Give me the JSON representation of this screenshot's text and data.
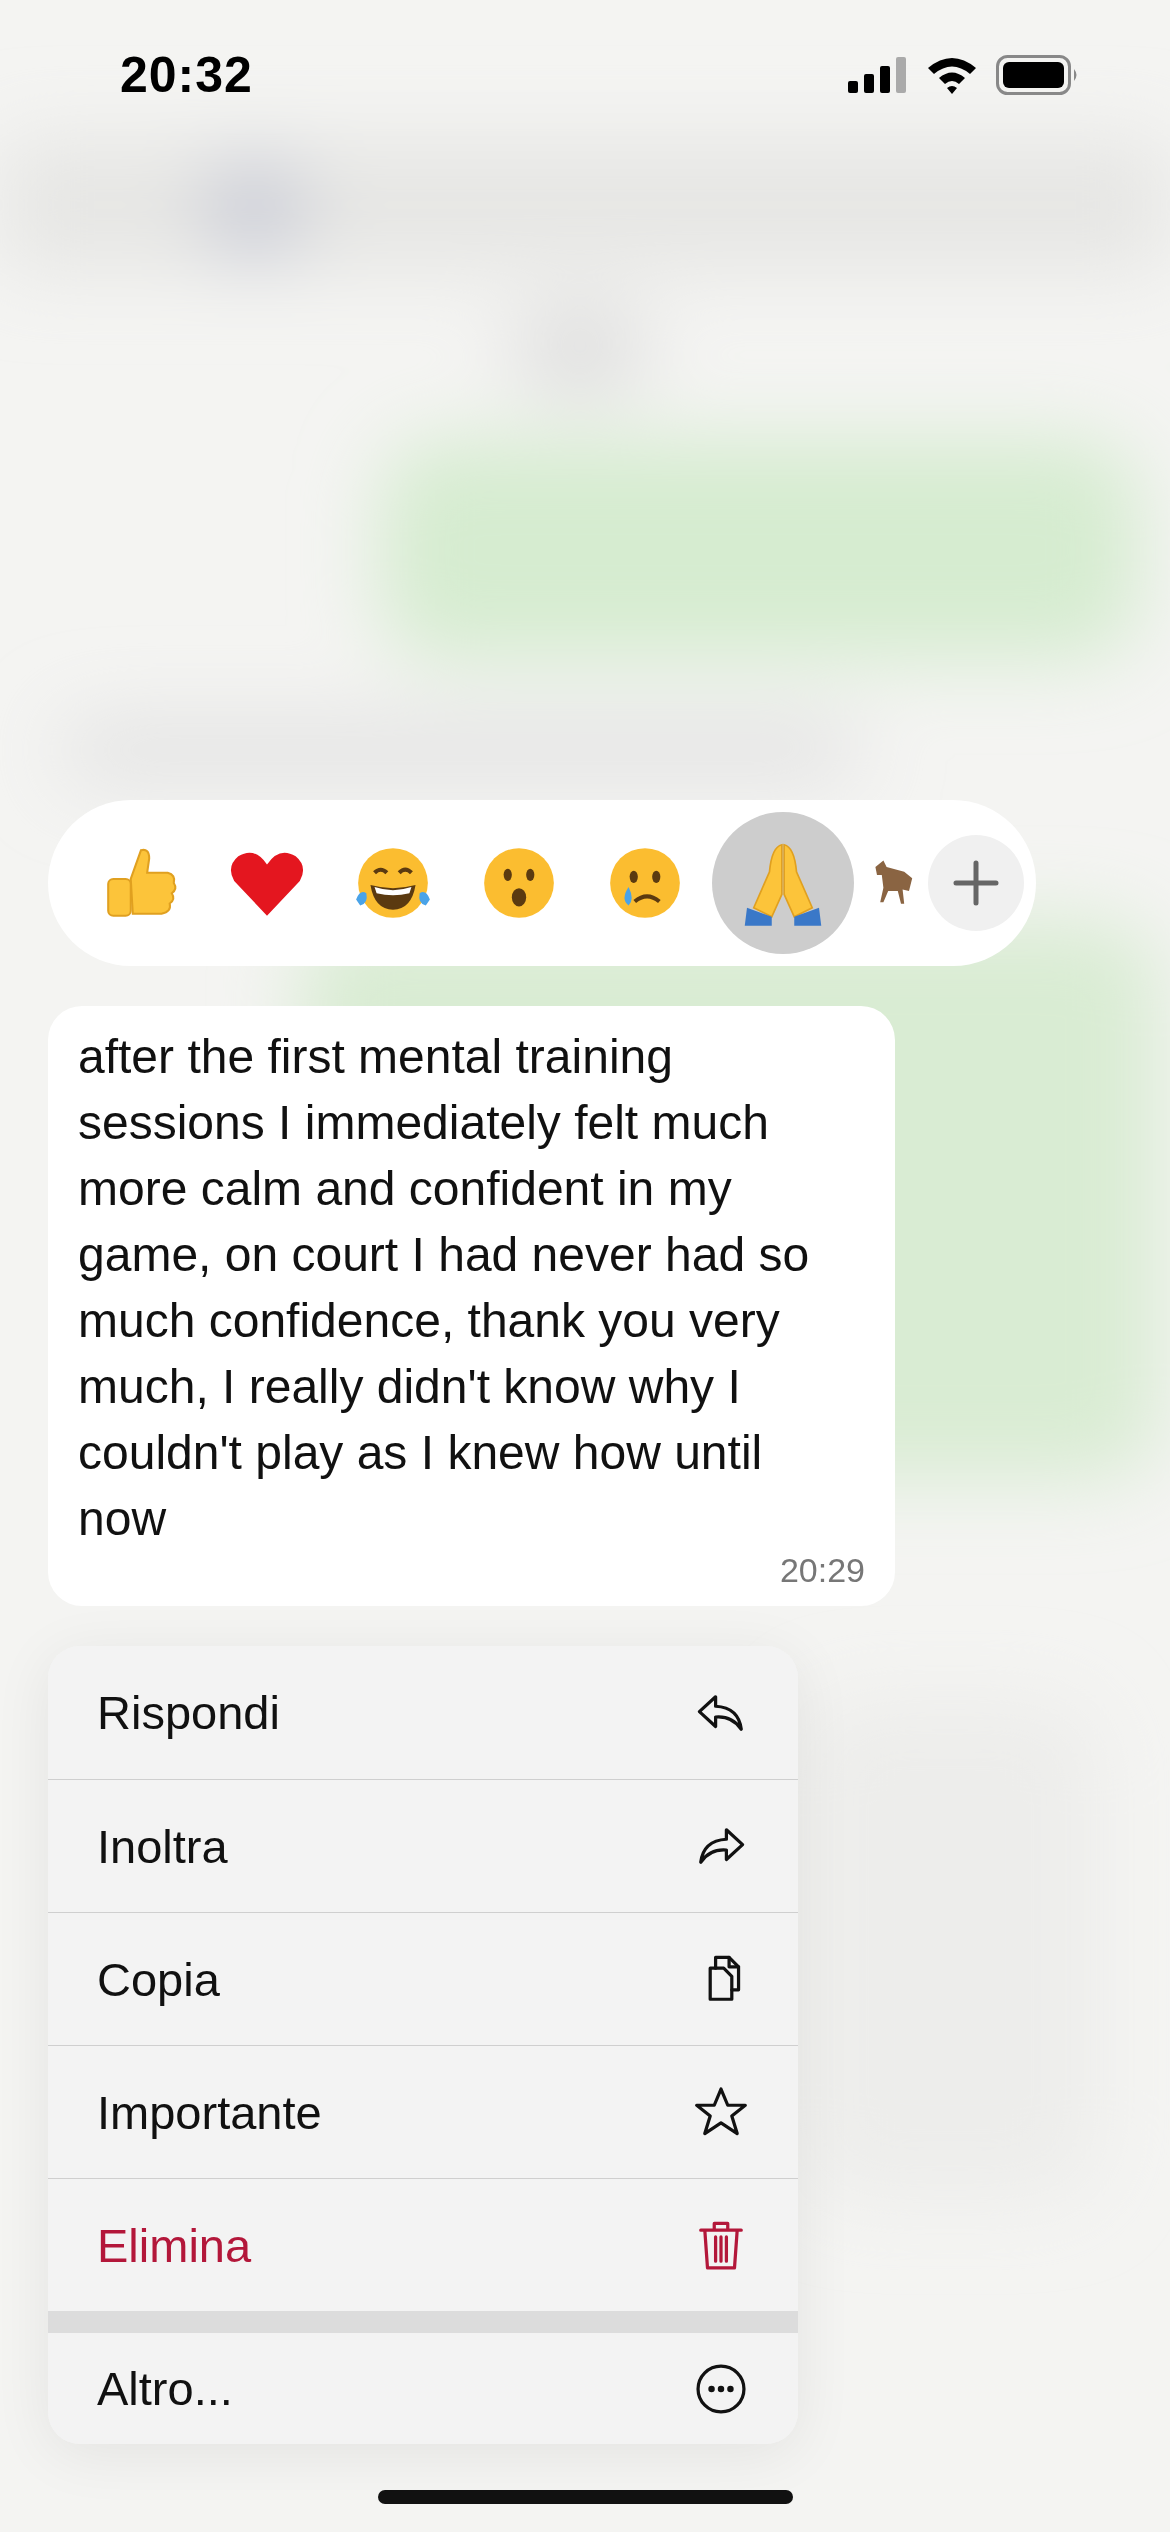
{
  "status_bar": {
    "time": "20:32"
  },
  "reactions": [
    {
      "kind": "thumbs_up",
      "selected": false
    },
    {
      "kind": "heart",
      "selected": false
    },
    {
      "kind": "laugh",
      "selected": false
    },
    {
      "kind": "surprised",
      "selected": false
    },
    {
      "kind": "sad",
      "selected": false
    },
    {
      "kind": "pray",
      "selected": true
    },
    {
      "kind": "horse",
      "selected": false
    }
  ],
  "message": {
    "text": "after the first mental training sessions I immediately felt much more calm and confident in my game, on court I had never had so much confidence, thank you very much, I really didn't know why I couldn't play as I knew how until now",
    "time": "20:29"
  },
  "menu": [
    {
      "label": "Rispondi",
      "kind": "reply",
      "destructive": false
    },
    {
      "label": "Inoltra",
      "kind": "forward",
      "destructive": false
    },
    {
      "label": "Copia",
      "kind": "copy",
      "destructive": false
    },
    {
      "label": "Importante",
      "kind": "star",
      "destructive": false
    },
    {
      "label": "Elimina",
      "kind": "delete",
      "destructive": true
    },
    {
      "label": "Altro...",
      "kind": "more",
      "destructive": false,
      "separated": true
    }
  ]
}
